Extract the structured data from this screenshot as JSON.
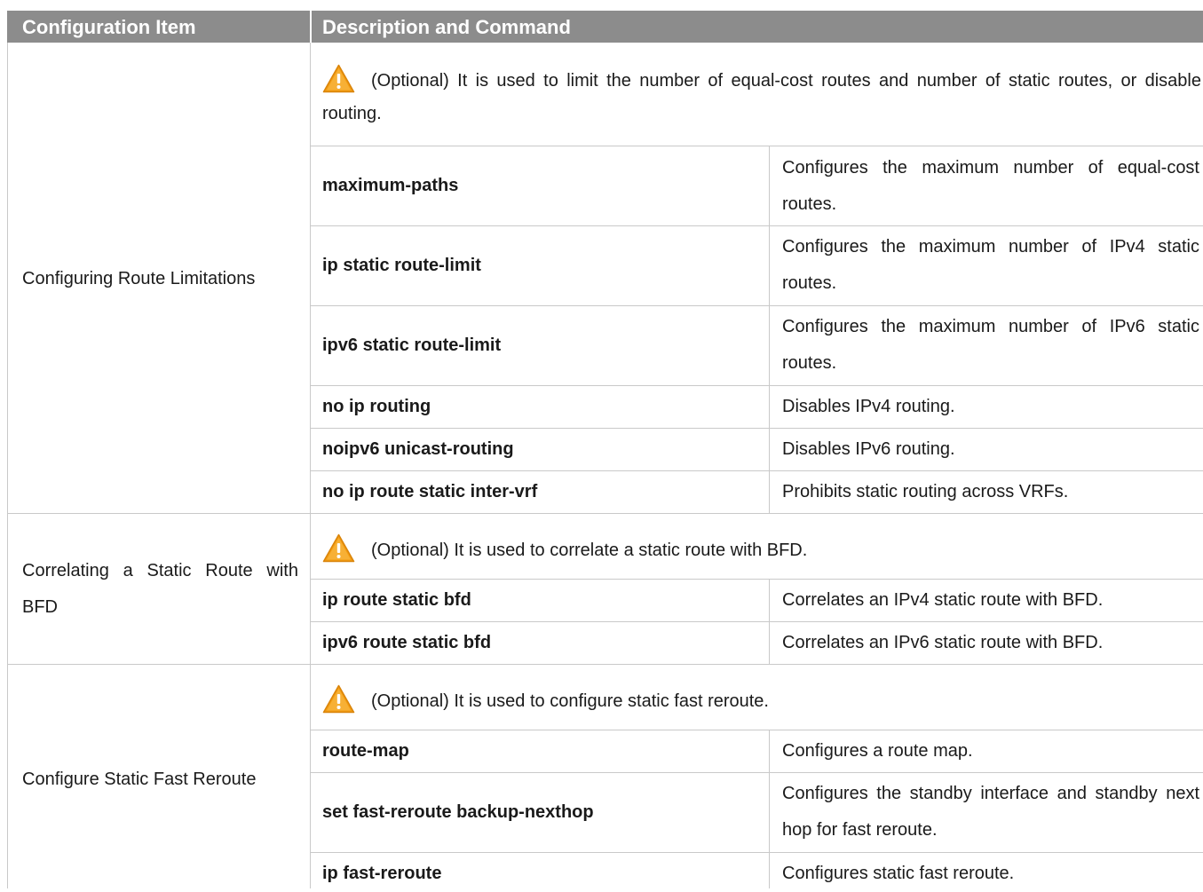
{
  "header": {
    "item_label": "Configuration Item",
    "desc_label": "Description and Command"
  },
  "colors": {
    "header_bg": "#8c8c8c",
    "header_text": "#ffffff",
    "grid": "#c9c9c9",
    "warning_fill": "#f39c12"
  },
  "sections": [
    {
      "item": "Configuring Route Limitations",
      "note_icon": "warning-icon",
      "note": "(Optional) It is used to limit the number of equal-cost routes and number of static routes, or disable routing.",
      "rows": [
        {
          "command": "maximum-paths",
          "description": "Configures the maximum number of equal-cost routes."
        },
        {
          "command": "ip static route-limit",
          "description": "Configures the maximum number of IPv4 static routes."
        },
        {
          "command": "ipv6 static route-limit",
          "description": "Configures the maximum number of IPv6 static routes."
        },
        {
          "command": "no ip routing",
          "description": "Disables IPv4 routing."
        },
        {
          "command": "noipv6 unicast-routing",
          "description": "Disables IPv6 routing."
        },
        {
          "command": "no ip route static inter-vrf",
          "description": "Prohibits static routing across VRFs."
        }
      ]
    },
    {
      "item": "Correlating a Static Route with BFD",
      "note_icon": "warning-icon",
      "note": "(Optional) It is used to correlate a static route with BFD.",
      "rows": [
        {
          "command": "ip route static bfd",
          "description": "Correlates an IPv4 static route with BFD."
        },
        {
          "command": "ipv6 route static bfd",
          "description": "Correlates an IPv6 static route with BFD."
        }
      ]
    },
    {
      "item": "Configure Static Fast Reroute",
      "note_icon": "warning-icon",
      "note": "(Optional) It is used to configure static fast reroute.",
      "rows": [
        {
          "command": "route-map",
          "description": "Configures a route map."
        },
        {
          "command": "set fast-reroute backup-nexthop",
          "description": "Configures the standby interface and standby next hop for fast reroute."
        },
        {
          "command": "ip fast-reroute",
          "description": "Configures static fast reroute."
        }
      ]
    }
  ]
}
